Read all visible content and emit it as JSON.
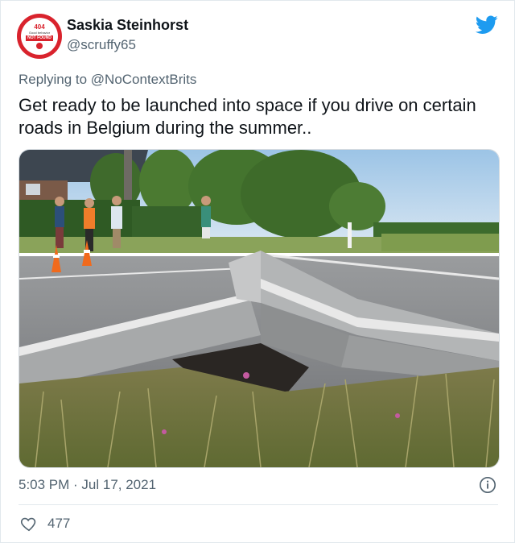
{
  "author": {
    "name": "Saskia Steinhorst",
    "handle": "@scruffy65",
    "avatar": {
      "code": "404",
      "subtitle": "Good behavior",
      "label": "NOT FOUND",
      "color": "#d9232d"
    }
  },
  "reply": {
    "prefix": "Replying to ",
    "mention": "@NoContextBrits"
  },
  "tweet": {
    "text": "Get ready to be launched into space if you drive on certain roads in Belgium during the summer..",
    "timestamp": "5:03 PM · Jul 17, 2021",
    "likes": "477"
  },
  "icons": {
    "brand": "twitter-bird-icon",
    "info": "info-icon",
    "like": "heart-icon"
  },
  "colors": {
    "brand_blue": "#1d9bf0",
    "text": "#0f1419",
    "secondary_text": "#536471"
  }
}
